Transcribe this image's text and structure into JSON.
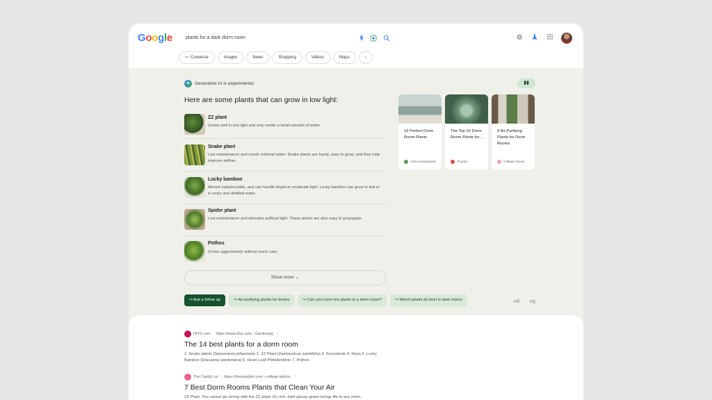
{
  "search": {
    "query": "plants for a dark dorm room"
  },
  "icons": {
    "mic": "mic-icon",
    "lens": "lens-icon",
    "search": "search-icon",
    "settings": "gear-icon",
    "labs": "flask-icon",
    "apps": "apps-grid-icon"
  },
  "tabs": [
    {
      "label": "Converse",
      "icon": "converse-icon"
    },
    {
      "label": "Images"
    },
    {
      "label": "News"
    },
    {
      "label": "Shopping"
    },
    {
      "label": "Videos"
    },
    {
      "label": "Maps"
    },
    {
      "label": "›"
    }
  ],
  "ai": {
    "label": "Generative AI is experimental",
    "heading": "Here are some plants that can grow in low light:",
    "plants": [
      {
        "name": "ZZ plant",
        "desc": "Grows well in low light and only needs a small amount of water."
      },
      {
        "name": "Snake plant",
        "desc": "Low maintenance and needs minimal water. Snake plants are hardy, easy to grow, and they help improve airflow."
      },
      {
        "name": "Lucky bamboo",
        "desc": "Almost indestructible, and can handle bright or moderate light. Lucky bamboo can grow in soil or in rocks and distilled water."
      },
      {
        "name": "Spider plant",
        "desc": "Low maintenance and tolerates artificial light. These plants are also easy to propagate."
      },
      {
        "name": "Pothos",
        "desc": "Grows aggressively without much care."
      }
    ],
    "show_more": "Show more",
    "followups": [
      "Ask a follow up",
      "Air-purifying plants for dorms",
      "Can you have live plants in a dorm room?",
      "Which plants do best in dark rooms"
    ]
  },
  "cards": [
    {
      "title": "15 Perfect Dorm Room Plants",
      "source": "Just Houseplants"
    },
    {
      "title": "The Top 10 Dorm Room Plants for ...",
      "source": "Thursd"
    },
    {
      "title": "9 Air Purifying Plants for Dorm Rooms",
      "source": "College Savvy"
    }
  ],
  "results": [
    {
      "site": "DIYS.com",
      "url": "https://www.diys.com › Gardening",
      "title": "The 14 best plants for a dorm room",
      "snippet": "1. Snake plants (Sansevieria trifasciata) 2. ZZ Plant (Zamioculcas zamiifolia) 3. Succulents 4. Hoya 5. Lucky Bamboo (Dracaena sanderiana) 6. Heart Leaf Philodendron 7. Pothos"
    },
    {
      "site": "The Candy Lei",
      "url": "https://thecandylei.com › college-advice",
      "title": "7 Best Dorm Rooms Plants that Clean Your Air",
      "snippet": "ZZ Plant. You cannot go wrong with the ZZ plant. It's rich, dark glossy-green brings life to any room,"
    }
  ]
}
